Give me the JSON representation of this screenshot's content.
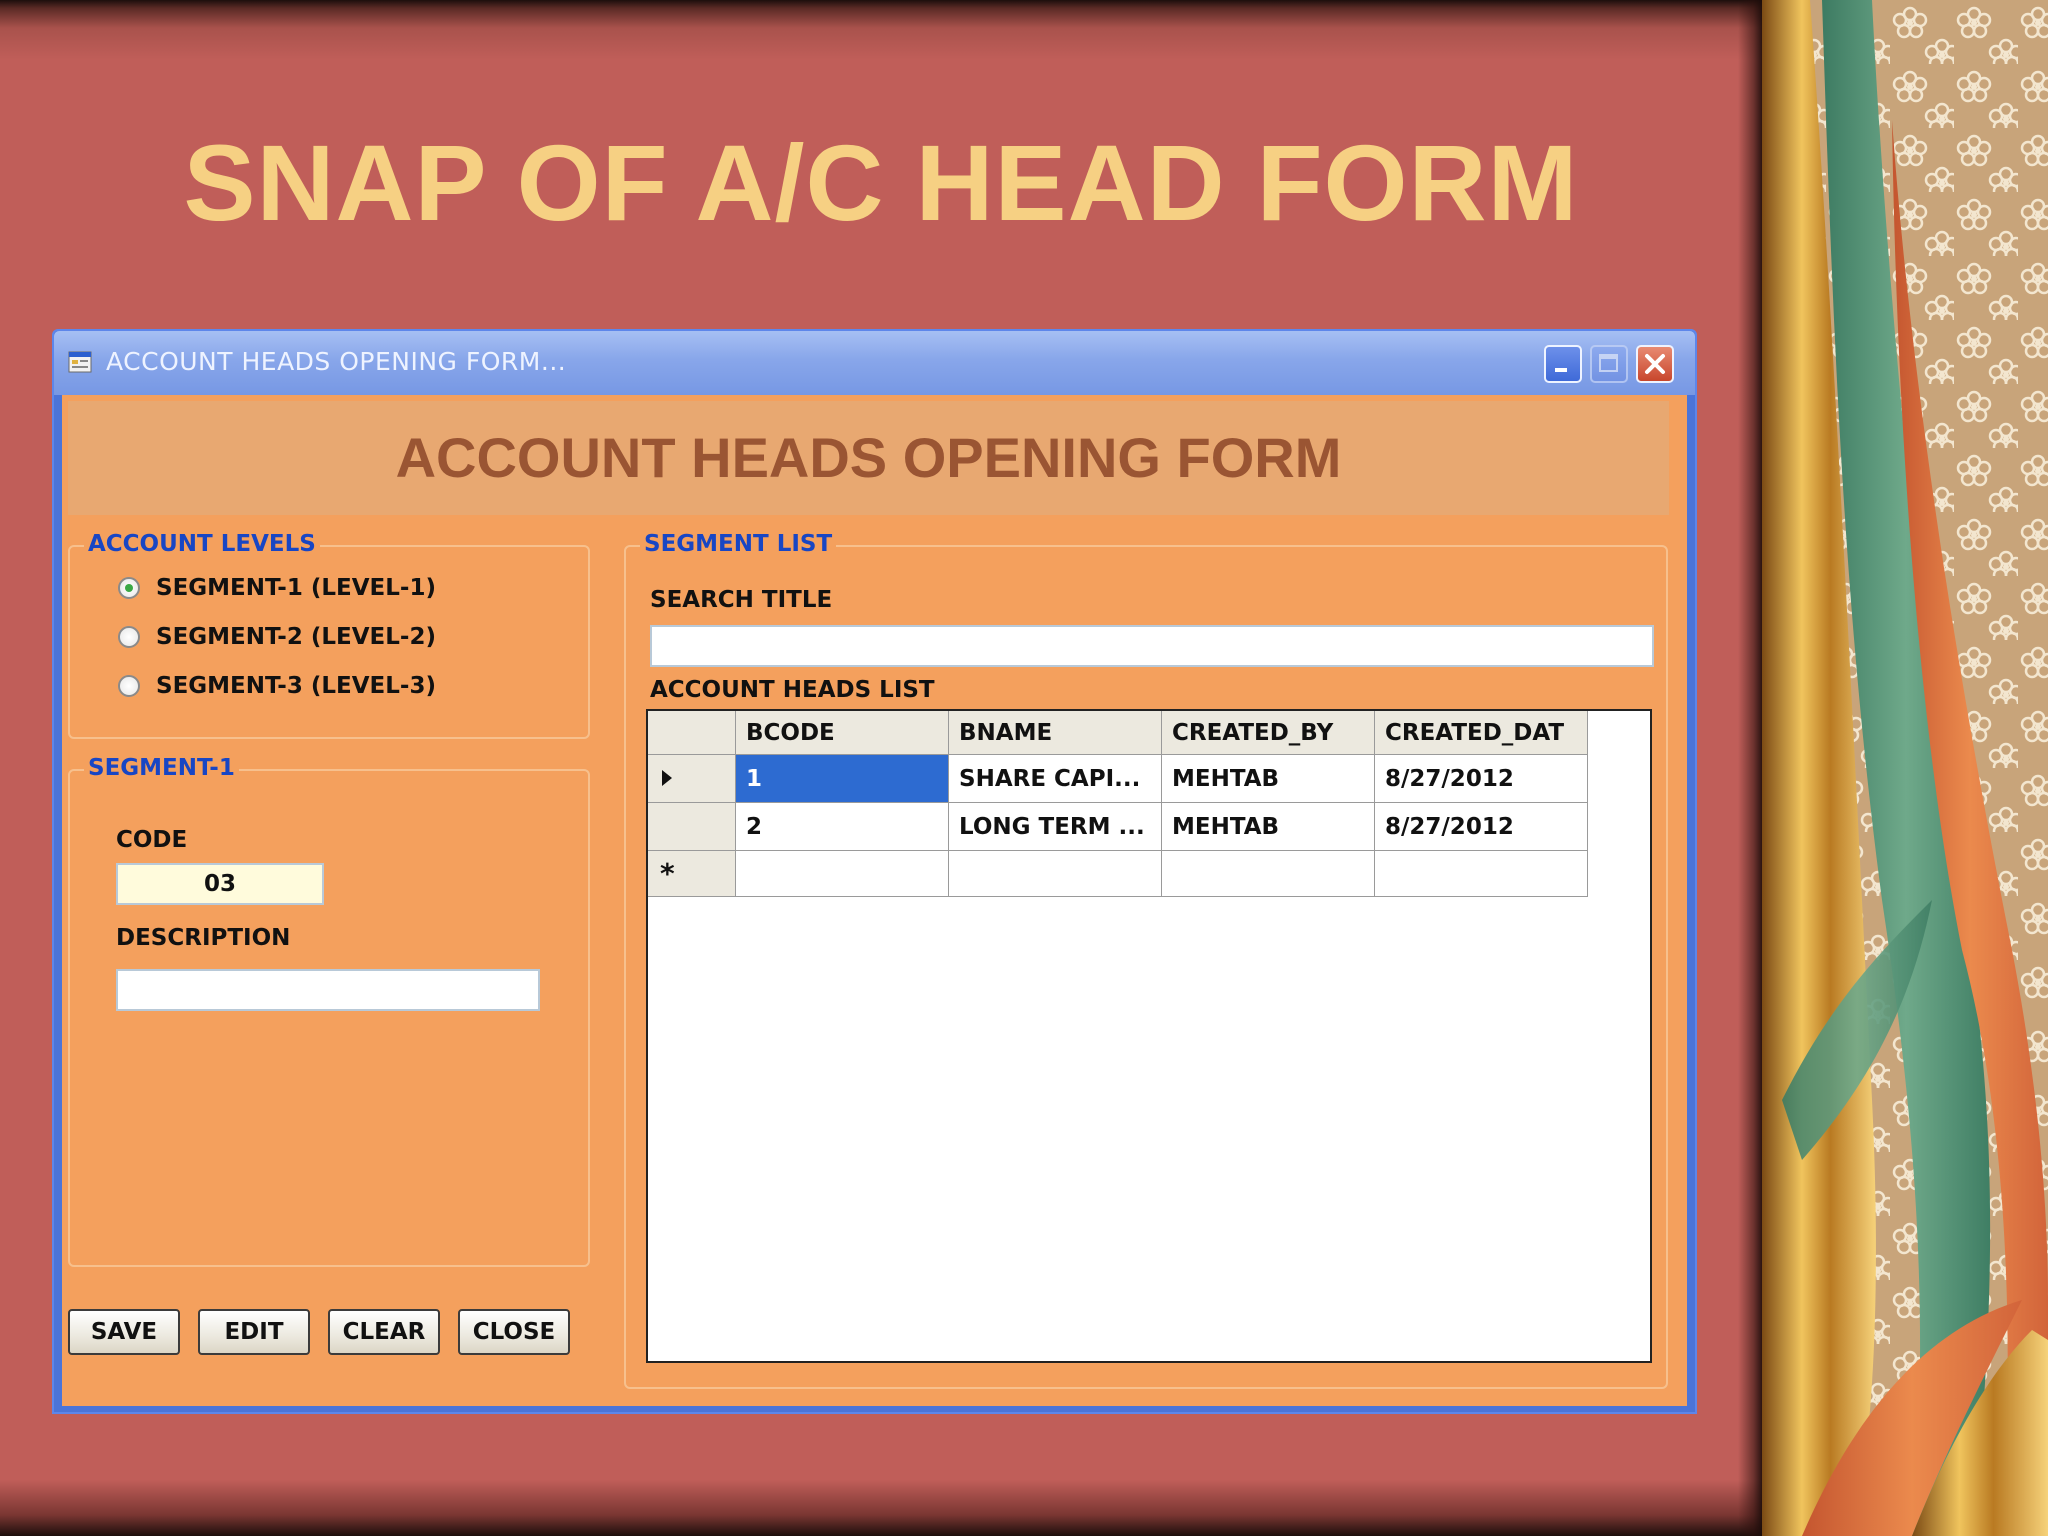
{
  "slide": {
    "title": "SNAP OF A/C HEAD FORM"
  },
  "window": {
    "title": "ACCOUNT HEADS OPENING FORM...",
    "heading": "ACCOUNT HEADS OPENING FORM"
  },
  "account_levels": {
    "label": "ACCOUNT LEVELS",
    "options": [
      "SEGMENT-1 (LEVEL-1)",
      "SEGMENT-2 (LEVEL-2)",
      "SEGMENT-3 (LEVEL-3)"
    ],
    "selected_index": 0
  },
  "segment": {
    "label": "SEGMENT-1",
    "code_label": "CODE",
    "code_value": "03",
    "description_label": "DESCRIPTION",
    "description_value": ""
  },
  "buttons": {
    "save": "SAVE",
    "edit": "EDIT",
    "clear": "CLEAR",
    "close": "CLOSE"
  },
  "segment_list": {
    "label": "SEGMENT LIST",
    "search_label": "SEARCH TITLE",
    "search_value": "",
    "list_label": "ACCOUNT HEADS LIST",
    "columns": [
      "BCODE",
      "BNAME",
      "CREATED_BY",
      "CREATED_DAT"
    ],
    "rows": [
      [
        "1",
        "SHARE CAPI...",
        "MEHTAB",
        "8/27/2012"
      ],
      [
        "2",
        "LONG TERM ...",
        "MEHTAB",
        "8/27/2012"
      ]
    ],
    "new_row_marker": "*"
  }
}
